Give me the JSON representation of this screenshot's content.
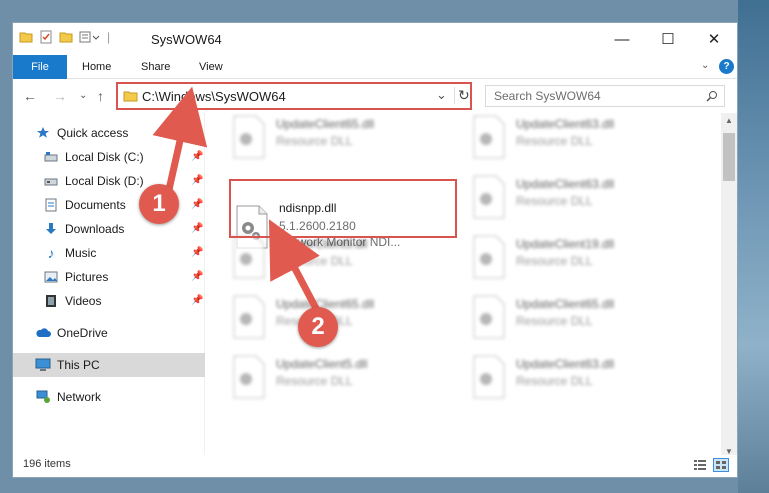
{
  "window": {
    "title": "SysWOW64",
    "controls": {
      "minimize": "—",
      "maximize": "☐",
      "close": "✕"
    }
  },
  "ribbon": {
    "tabs": [
      "File",
      "Home",
      "Share",
      "View"
    ],
    "help": "?"
  },
  "address": {
    "path": "C:\\Windows\\SysWOW64",
    "dropdown": "⌄",
    "refresh": "↻"
  },
  "search": {
    "placeholder": "Search SysWOW64"
  },
  "nav": {
    "back": "←",
    "forward": "→",
    "recent": "⌄",
    "up": "↑"
  },
  "sidebar": {
    "quick_access": "Quick access",
    "items": [
      {
        "label": "Local Disk (C:)",
        "icon": "drive-icon"
      },
      {
        "label": "Local Disk (D:)",
        "icon": "drive-icon"
      },
      {
        "label": "Documents",
        "icon": "documents-icon"
      },
      {
        "label": "Downloads",
        "icon": "downloads-icon"
      },
      {
        "label": "Music",
        "icon": "music-icon"
      },
      {
        "label": "Pictures",
        "icon": "pictures-icon"
      },
      {
        "label": "Videos",
        "icon": "videos-icon"
      }
    ],
    "onedrive": "OneDrive",
    "thispc": "This PC",
    "network": "Network"
  },
  "files": {
    "highlighted": {
      "name": "ndisnpp.dll",
      "version": "5.1.2600.2180",
      "desc": "Network Monitor NDI..."
    },
    "blurred": [
      {
        "name": "UpdateClient65.dll",
        "desc": "Resource DLL"
      },
      {
        "name": "UpdateClient63.dll",
        "desc": "Resource DLL"
      },
      {
        "name": "UpdateClient63.dll",
        "desc": "Resource DLL"
      },
      {
        "name": "UpdateClient5.dll",
        "desc": "Resource DLL"
      },
      {
        "name": "UpdateClient19.dll",
        "desc": "Resource DLL"
      },
      {
        "name": "UpdateClient65.dll",
        "desc": "Resource DLL"
      },
      {
        "name": "UpdateClient65.dll",
        "desc": "Resource DLL"
      },
      {
        "name": "UpdateClient5.dll",
        "desc": "Resource DLL"
      },
      {
        "name": "UpdateClient63.dll",
        "desc": "Resource DLL"
      }
    ]
  },
  "status": {
    "count": "196 items"
  },
  "annotations": {
    "step1": "1",
    "step2": "2",
    "color": "#d9534f"
  }
}
